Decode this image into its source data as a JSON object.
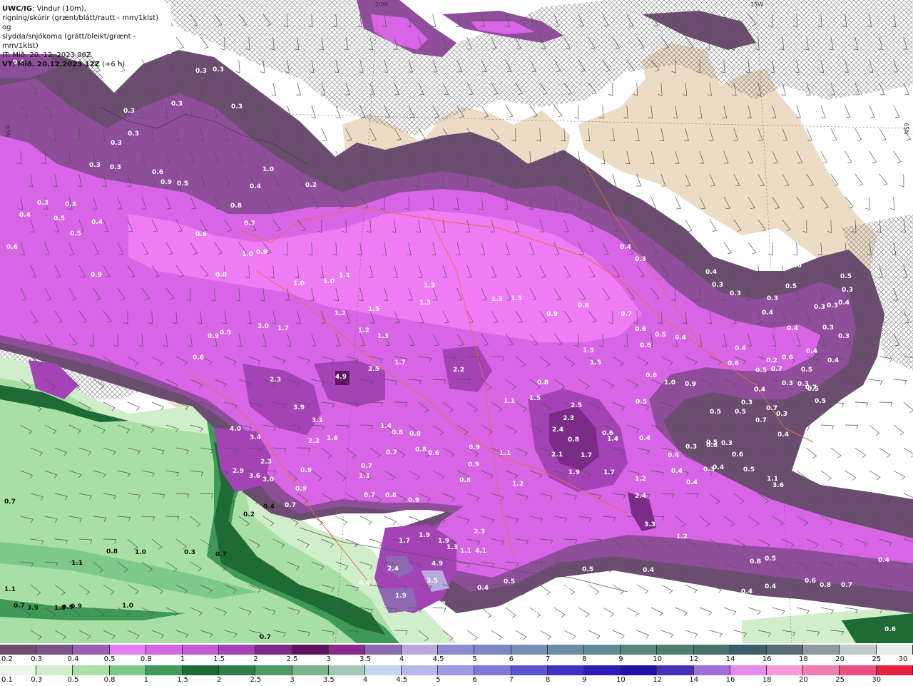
{
  "header": {
    "model": "UWC/IG",
    "title_rest": ": Vindur (10m),",
    "line2": "rigning/skúrir (grænt/blátt/rautt - mm/1klst) og",
    "line3": "slydda/snjókoma (grátt/bleikt/grænt - mm/1klst)",
    "line4": "IT: Mið. 20. 12. 2023 06Z",
    "line5_bold": "VT: Mið. 20.12.2023 12Z",
    "line5_rest": " (+6 h)"
  },
  "grid_labels": {
    "lon_20w": "20W",
    "lon_15w": "15W",
    "lat_65n_left": "65N",
    "lat_65n_right": "65N"
  },
  "colors": {
    "sea": "#ffffff",
    "land": "#eddcc5",
    "snow_light": "#6b4d6f",
    "snow_mid": "#8e4e9a",
    "snow_pink": "#d864e6",
    "snow_bright": "#ef7cf5",
    "rain_light": "#cfeec9",
    "rain_mid": "#8fd39a",
    "rain_dark": "#1c6b34",
    "roads": "#e0703f"
  },
  "values": [
    "0.4",
    "0.3",
    "0.3",
    "0.3",
    "0.3",
    "0.3",
    "0.3",
    "0.3",
    "0.3",
    "0.3",
    "0.3",
    "0.3",
    "0.4",
    "0.5",
    "0.5",
    "0.4",
    "0.6",
    "0.9",
    "0.5",
    "0.4",
    "0.2",
    "1.0",
    "0.6",
    "0.8",
    "0.6",
    "0.7",
    "1.0",
    "0.9",
    "0.9",
    "0.8",
    "1.0",
    "1.1",
    "1.0",
    "1.3",
    "1.3",
    "1.3",
    "1.2",
    "1.2",
    "1.3",
    "1.5",
    "2.0",
    "1.7",
    "0.9",
    "0.9",
    "0.6",
    "2.3",
    "4.9",
    "2.5",
    "1.7",
    "2.2",
    "3.9",
    "3.1",
    "1.6",
    "2.2",
    "4.0",
    "3.4",
    "2.3",
    "2.9",
    "3.6",
    "3.0",
    "0.9",
    "0.9",
    "1.4",
    "0.8",
    "0.8",
    "0.7",
    "0.8",
    "0.6",
    "0.9",
    "0.9",
    "1.1",
    "1.1",
    "1.5",
    "2.5",
    "2.3",
    "2.4",
    "2.1",
    "1.7",
    "1.9",
    "1.7",
    "1.4",
    "1.2",
    "2.4",
    "3.3",
    "1.2",
    "1.2",
    "0.8",
    "1.5",
    "1.5",
    "1.3",
    "0.9",
    "0.8",
    "0.7",
    "0.6",
    "0.6",
    "0.5",
    "0.4",
    "0.6",
    "1.0",
    "0.9",
    "0.6",
    "0.3",
    "0.3",
    "0.3",
    "0.4",
    "0.4",
    "0.4",
    "0.3",
    "0.3",
    "0.3",
    "0.4",
    "0.5",
    "0.4",
    "0.3",
    "0.3",
    "0.4",
    "0.4",
    "0.4",
    "0.3",
    "0.3",
    "0.3",
    "0.5",
    "0.6",
    "0.4",
    "0.6",
    "0.6",
    "0.5",
    "0.3",
    "0.3",
    "0.2",
    "0.3",
    "0.4",
    "0.4",
    "0.3",
    "0.4",
    "0.4",
    "0.5",
    "0.4",
    "0.4",
    "0.4",
    "0.3",
    "0.5",
    "0.8",
    "0.4",
    "0.6",
    "0.8",
    "0.7",
    "0.4",
    "0.4",
    "0.6",
    "0.5",
    "0.5",
    "0.4",
    "0.6",
    "0.8",
    "0.9",
    "0.8",
    "0.7",
    "0.7",
    "1.1",
    "0.8",
    "2.3",
    "1.7",
    "1.9",
    "1.9",
    "1.3",
    "1.1",
    "4.1",
    "2.4",
    "4.9",
    "3.5",
    "4.4",
    "1.9",
    "0.7",
    "0.4",
    "0.5",
    "0.4",
    "0.2",
    "0.3",
    "0.4",
    "0.5",
    "0.5",
    "0.5",
    "0.5",
    "0.5",
    "0.7",
    "0.7",
    "0.6",
    "0.3",
    "0.5",
    "0.7",
    "1.1",
    "3.6",
    "0.7",
    "0.6",
    "0.7",
    "0.8",
    "1.0",
    "1.1",
    "1.1",
    "0.7",
    "3.9",
    "1.8",
    "0.9",
    "0.9",
    "1.0",
    "0.7",
    "0.7",
    "0.3",
    "0.2",
    "0.4",
    "0.7"
  ],
  "scale_snow": {
    "colors": [
      "#6e4f6b",
      "#7a5286",
      "#9a5fb0",
      "#e37fee",
      "#d466df",
      "#c45cd1",
      "#a343b6",
      "#7c2c88",
      "#5b145e",
      "#8a2a8f",
      "#8e68b0",
      "#b8a8de",
      "#8b8ad2",
      "#7b86c3",
      "#7a8fb8",
      "#6d8ca6",
      "#5f8b96",
      "#57887d",
      "#4c7f70",
      "#46726b",
      "#3c6067",
      "#556c74",
      "#8d9b9e",
      "#c2c9c9",
      "#e8ebea"
    ],
    "labels": [
      "0.2",
      "0.3",
      "0.4",
      "0.5",
      "0.8",
      "1",
      "1.5",
      "2",
      "2.5",
      "3",
      "3.5",
      "4",
      "4.5",
      "5",
      "6",
      "7",
      "8",
      "9",
      "10",
      "12",
      "14",
      "16",
      "18",
      "20",
      "25",
      "30"
    ]
  },
  "scale_rain": {
    "colors": [
      "#e8f7e6",
      "#cfeec9",
      "#a8dfa5",
      "#7cc98a",
      "#3f9a58",
      "#1f6b36",
      "#2f8047",
      "#4b9a64",
      "#79b58a",
      "#a3c9b6",
      "#c8d6ed",
      "#b4b8ec",
      "#9c9ae6",
      "#7c78dc",
      "#5b55cf",
      "#3e33c3",
      "#2a1db8",
      "#2010a8",
      "#4a2fb8",
      "#a06ed8",
      "#e58ae8",
      "#f59ad4",
      "#f07cb0",
      "#ea4f7e",
      "#e5213f"
    ],
    "labels": [
      "0.1",
      "0.3",
      "0.5",
      "0.8",
      "1",
      "1.5",
      "2",
      "2.5",
      "3",
      "3.5",
      "4",
      "4.5",
      "5",
      "6",
      "7",
      "8",
      "9",
      "10",
      "12",
      "14",
      "16",
      "18",
      "20",
      "25",
      "30"
    ]
  }
}
